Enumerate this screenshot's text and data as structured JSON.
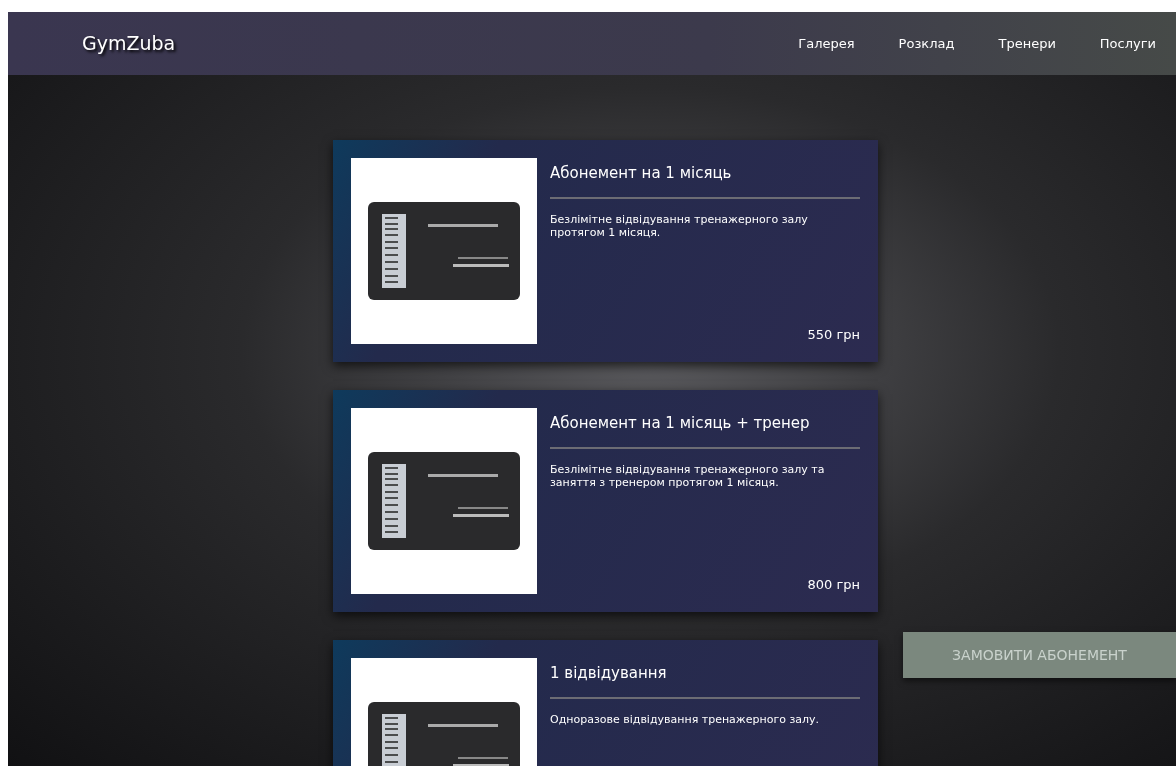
{
  "navbar": {
    "logo": "GymZuba",
    "links": [
      "Галерея",
      "Розклад",
      "Тренери",
      "Послуги"
    ]
  },
  "plans": [
    {
      "title": "Абонемент на 1 місяць",
      "description": "Безлімітне відвідування тренажерного залу протягом 1 місяця.",
      "price": "550 грн"
    },
    {
      "title": "Абонемент на 1 місяць + тренер",
      "description": "Безлімітне відвідування тренажерного залу та заняття з тренером протягом 1 місяця.",
      "price": "800 грн"
    },
    {
      "title": "1 відвідування",
      "description": "Одноразове відвідування тренажерного залу."
    }
  ],
  "order_button": "ЗАМОВИТИ АБОНЕМЕНТ"
}
